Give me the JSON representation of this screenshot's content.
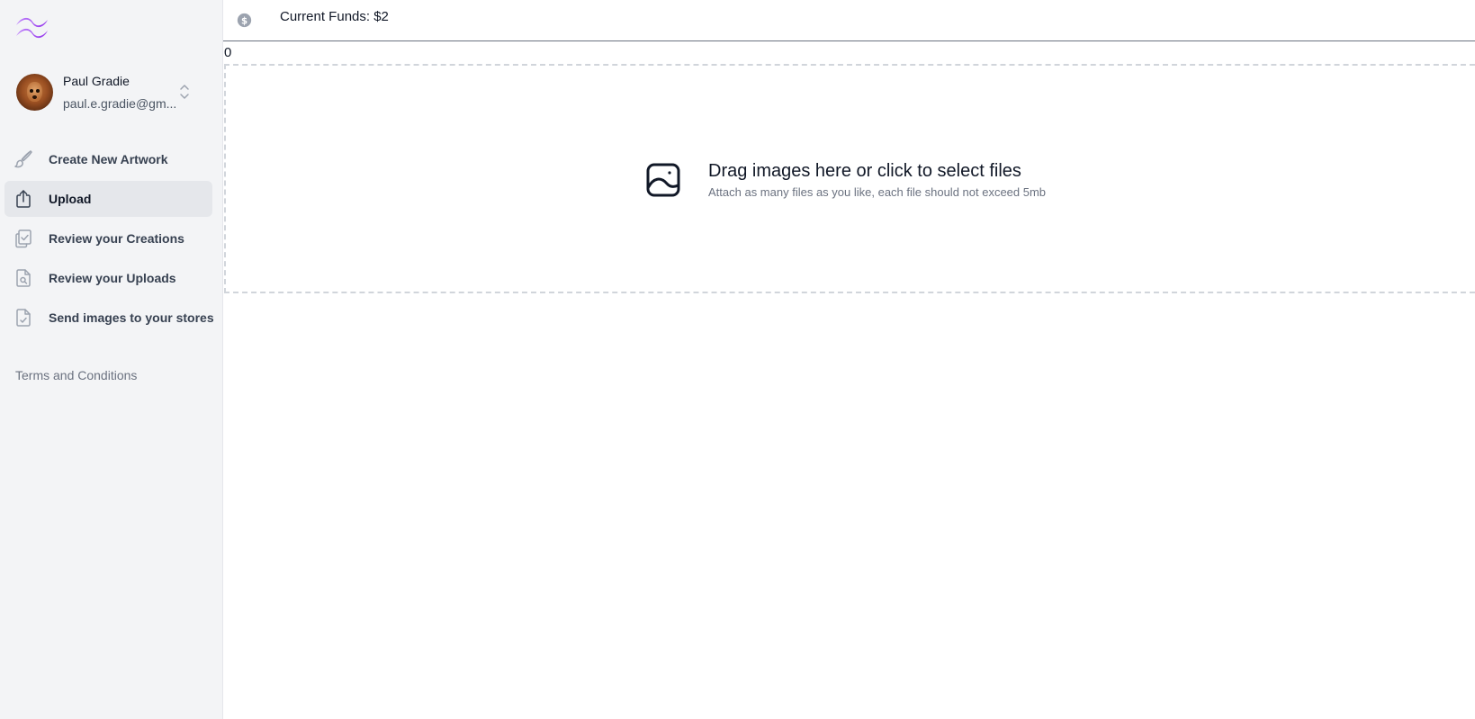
{
  "sidebar": {
    "user": {
      "name": "Paul Gradie",
      "email": "paul.e.gradie@gm..."
    },
    "items": [
      {
        "label": "Create New Artwork",
        "icon": "paintbrush-icon",
        "active": false
      },
      {
        "label": "Upload",
        "icon": "upload-icon",
        "active": true
      },
      {
        "label": "Review your Creations",
        "icon": "clipboard-check-icon",
        "active": false
      },
      {
        "label": "Review your Uploads",
        "icon": "document-search-icon",
        "active": false
      },
      {
        "label": "Send images to your stores",
        "icon": "document-check-icon",
        "active": false
      }
    ],
    "terms_label": "Terms and Conditions"
  },
  "topbar": {
    "funds_text": "Current Funds: $2",
    "funds_icon": "dollar-circle-icon"
  },
  "counter_text": "0",
  "dropzone": {
    "title": "Drag images here or click to select files",
    "subtitle": "Attach as many files as you like, each file should not exceed 5mb",
    "icon": "image-icon"
  },
  "colors": {
    "logo_gradient_start": "#c084fc",
    "logo_gradient_end": "#9333ea",
    "sidebar_bg": "#f3f4f6",
    "active_item_bg": "#e5e7eb",
    "dropzone_border": "#d1d5db"
  }
}
